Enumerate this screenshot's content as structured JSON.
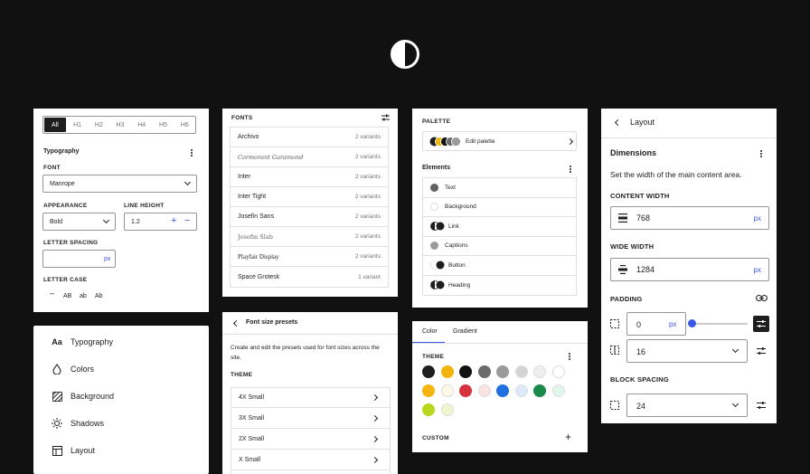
{
  "typography_panel": {
    "heading_tabs": [
      "All",
      "H1",
      "H2",
      "H3",
      "H4",
      "H5",
      "H6"
    ],
    "title": "Typography",
    "font_label": "FONT",
    "font_value": "Manrope",
    "appearance_label": "APPEARANCE",
    "appearance_value": "Bold",
    "line_height_label": "LINE HEIGHT",
    "line_height_value": "1.2",
    "letter_spacing_label": "LETTER SPACING",
    "letter_spacing_unit": "px",
    "letter_case_label": "LETTER CASE",
    "letter_case_options": [
      "AB",
      "ab",
      "Ab"
    ]
  },
  "fonts_panel": {
    "title": "FONTS",
    "fonts": [
      {
        "name": "Archivo",
        "variants": "2 variants"
      },
      {
        "name": "Cormorant Garamond",
        "variants": "2 variants"
      },
      {
        "name": "Inter",
        "variants": "2 variants"
      },
      {
        "name": "Inter Tight",
        "variants": "2 variants"
      },
      {
        "name": "Josefin Sans",
        "variants": "2 variants"
      },
      {
        "name": "Josefin Slab",
        "variants": "2 variants"
      },
      {
        "name": "Playfair Display",
        "variants": "2 variants"
      },
      {
        "name": "Space Grotesk",
        "variants": "1 variant"
      }
    ]
  },
  "palette_panel": {
    "palette_label": "PALETTE",
    "edit_palette": "Edit palette",
    "elements_label": "Elements",
    "elements": [
      "Text",
      "Background",
      "Link",
      "Captions",
      "Button",
      "Heading"
    ]
  },
  "layout_panel": {
    "back_title": "Layout",
    "dimensions_title": "Dimensions",
    "description": "Set the width of the main content area.",
    "content_width_label": "CONTENT WIDTH",
    "content_width_value": "768",
    "wide_width_label": "WIDE WIDTH",
    "wide_width_value": "1284",
    "unit": "px",
    "padding_label": "PADDING",
    "padding_value": "0",
    "padding_unit": "px",
    "padding_select": "16",
    "block_spacing_label": "BLOCK SPACING",
    "block_spacing_value": "24",
    "padding_slider_fraction": 0
  },
  "nav_panel": {
    "items": [
      {
        "label": "Typography",
        "icon": "typography-icon"
      },
      {
        "label": "Colors",
        "icon": "droplet-icon"
      },
      {
        "label": "Background",
        "icon": "background-icon"
      },
      {
        "label": "Shadows",
        "icon": "shadow-icon"
      },
      {
        "label": "Layout",
        "icon": "layout-icon"
      }
    ],
    "typography_glyph": "Aa"
  },
  "presets_panel": {
    "title": "Font size presets",
    "description": "Create and edit the presets used for font sizes across the site.",
    "theme_label": "THEME",
    "presets": [
      "4X Small",
      "3X Small",
      "2X Small",
      "X Small"
    ]
  },
  "colors_panel": {
    "tabs": [
      "Color",
      "Gradient"
    ],
    "theme_label": "THEME",
    "custom_label": "CUSTOM",
    "row1": [
      "#1e1e1e",
      "#f0b40a",
      "#111111",
      "#6b6b6b",
      "#9a9a9a",
      "#d4d4d4",
      "#efefef",
      "#ffffff"
    ],
    "row2": [
      "#f5b50d",
      "#fff8e6",
      "#d6313f",
      "#fbe3e4",
      "#1f70e0",
      "#dde9fb",
      "#1a8a4a",
      "#e2f7ec"
    ],
    "row3": [
      "#b8d61b",
      "#f0f6d0"
    ]
  },
  "accent_color": "#3858e9"
}
